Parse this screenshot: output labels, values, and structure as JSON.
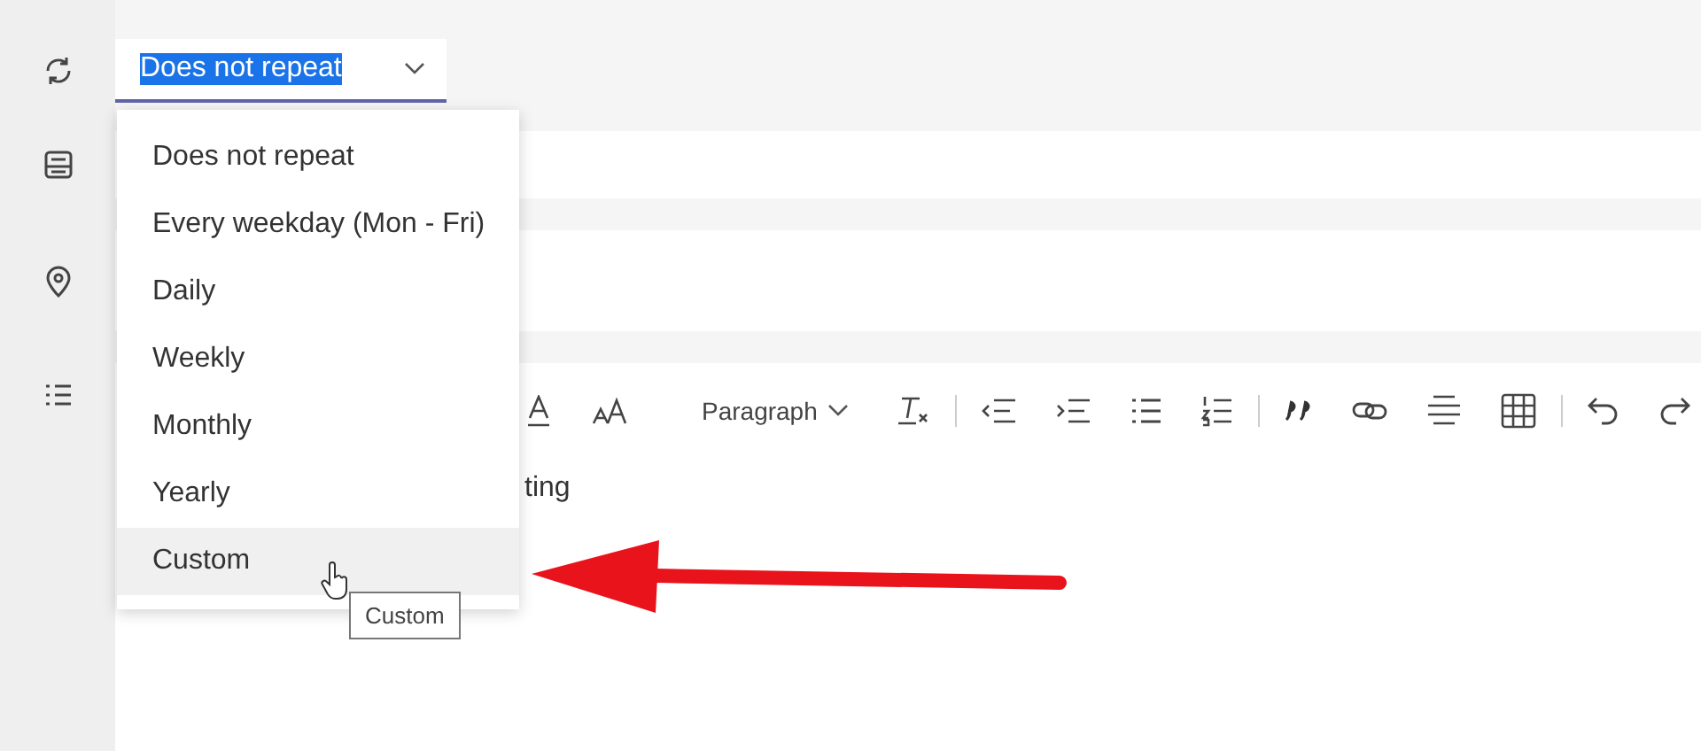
{
  "repeat_field": {
    "value": "Does not repeat",
    "text_highlighted": true,
    "open": true
  },
  "repeat_menu": [
    {
      "label": "Does not repeat",
      "hovered": false
    },
    {
      "label": "Every weekday (Mon - Fri)",
      "hovered": false
    },
    {
      "label": "Daily",
      "hovered": false
    },
    {
      "label": "Weekly",
      "hovered": false
    },
    {
      "label": "Monthly",
      "hovered": false
    },
    {
      "label": "Yearly",
      "hovered": false
    },
    {
      "label": "Custom",
      "hovered": true
    }
  ],
  "tooltip": "Custom",
  "toolbar": {
    "paragraph_style": "Paragraph"
  },
  "editor_text": "ting"
}
